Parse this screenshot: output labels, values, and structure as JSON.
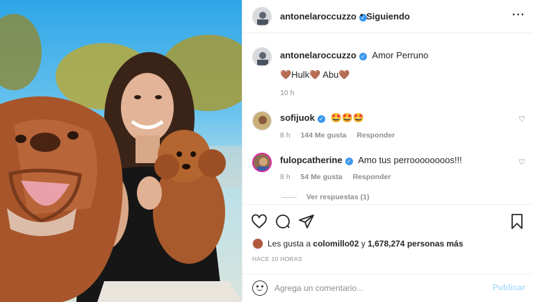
{
  "header": {
    "username": "antonelaroccuzzo",
    "separator": "•",
    "follow_label": "Siguiendo",
    "more_label": "···"
  },
  "caption": {
    "username": "antonelaroccuzzo",
    "text": "Amor Perruno",
    "line2": "🤎Hulk🤎 Abu🤎",
    "time": "10 h"
  },
  "comments": [
    {
      "username": "sofijuok",
      "text": "🤩🤩🤩",
      "time": "8 h",
      "likes": "144 Me gusta",
      "reply": "Responder"
    },
    {
      "username": "fulopcatherine",
      "text": "Amo tus perroooooooos!!!",
      "time": "8 h",
      "likes": "54 Me gusta",
      "reply": "Responder"
    }
  ],
  "view_replies": "Ver respuestas (1)",
  "likes": {
    "prefix": "Les gusta a ",
    "user": "colomillo02",
    "middle": " y ",
    "count": "1,678,274 personas más"
  },
  "posted_ago": "HACE 10 HORAS",
  "add_comment": {
    "placeholder": "Agrega un comentario...",
    "publish_label": "Publicar"
  },
  "icons": {
    "like": "heart-icon",
    "comment": "comment-icon",
    "share": "paper-plane-icon",
    "save": "bookmark-icon",
    "emoji": "emoji-icon",
    "more": "more-options-icon",
    "verified": "verified-badge-icon"
  },
  "colors": {
    "verified": "#3897f0",
    "secondary_text": "#8e8e8e",
    "publish_disabled": "#b2dffc",
    "border": "#efefef"
  }
}
